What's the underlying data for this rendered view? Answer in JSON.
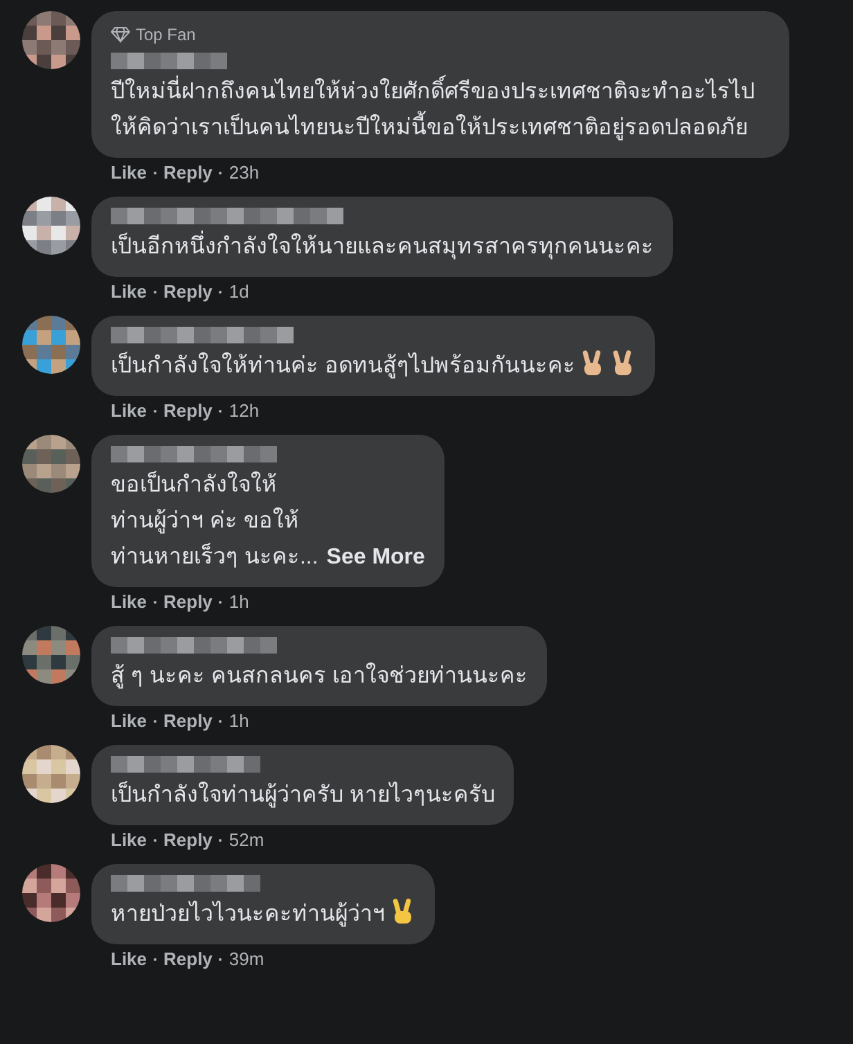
{
  "comments": [
    {
      "badge": {
        "label": "Top Fan"
      },
      "text": "ปีใหม่นี่ฝากถึงคนไทยให้ห่วงใยศักดิ์ศรีของประเทศชาติจะทำอะไรไปให้คิดว่าเราเป็นคนไทยนะปีใหม่นี้ขอให้ประเทศชาติอยู่รอดปลอดภัย",
      "like": "Like",
      "reply": "Reply",
      "time": "23h"
    },
    {
      "text": "เป็นอีกหนึ่งกำลังใจให้นายและคนสมุทรสาครทุกคนนะคะ",
      "like": "Like",
      "reply": "Reply",
      "time": "1d"
    },
    {
      "text": "เป็นกำลังใจให้ท่านค่ะ อดทนสู้ๆไปพร้อมกันนะคะ",
      "emojis": [
        {
          "kind": "victory-hand",
          "color": "#e8b98f"
        },
        {
          "kind": "victory-hand",
          "color": "#e8b98f"
        }
      ],
      "like": "Like",
      "reply": "Reply",
      "time": "12h"
    },
    {
      "lines": [
        "ขอเป็นกำลังใจให้",
        "ท่านผู้ว่าฯ ค่ะ ขอให้",
        "ท่านหายเร็วๆ นะคะ..."
      ],
      "see_more": "See More",
      "like": "Like",
      "reply": "Reply",
      "time": "1h"
    },
    {
      "text": "สู้ ๆ นะคะ คนสกลนคร เอาใจช่วยท่านนะคะ",
      "like": "Like",
      "reply": "Reply",
      "time": "1h"
    },
    {
      "text": "เป็นกำลังใจท่านผู้ว่าครับ หายไวๆนะครับ",
      "like": "Like",
      "reply": "Reply",
      "time": "52m"
    },
    {
      "text": "หายป่วยไวไวนะคะท่านผู้ว่าฯ",
      "emojis": [
        {
          "kind": "victory-hand",
          "color": "#f4c542"
        }
      ],
      "like": "Like",
      "reply": "Reply",
      "time": "39m"
    }
  ]
}
